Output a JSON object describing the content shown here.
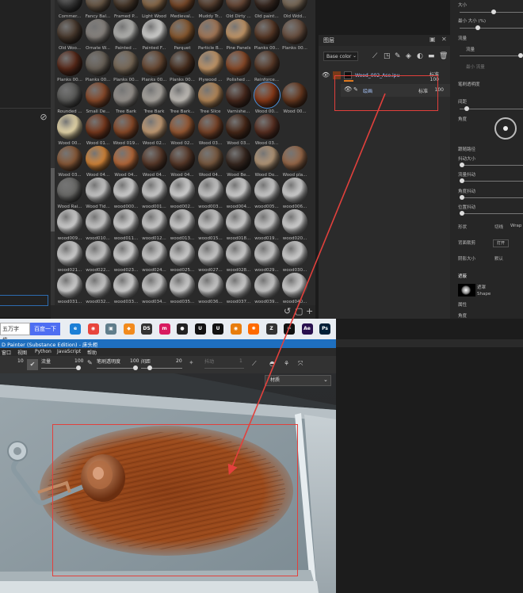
{
  "material_grid": {
    "rows": [
      [
        "Commer...",
        "Fancy Bal...",
        "Framed P...",
        "Light Wood",
        "Medieval...",
        "Muddy Tr...",
        "Old Dirty ...",
        "Old paint...",
        "Old Wdd..."
      ],
      [
        "Old Woo...",
        "Ornate W...",
        "Painted ...",
        "Painted F...",
        "Parquet",
        "Particle B...",
        "Pine Panels",
        "Planks 00...",
        "Planks 00..."
      ],
      [
        "Planks 00...",
        "Planks 00...",
        "Planks 00...",
        "Planks 00...",
        "Planks 00...",
        "Plywood ...",
        "Polished ...",
        "Reinforce..."
      ],
      [
        "Rounded ...",
        "Small De...",
        "Tree Bark",
        "Tree Bark",
        "Tree Bark...",
        "Tree Slice",
        "Varnishe...",
        "Wood 00...",
        "Wood 00..."
      ],
      [
        "Wood 00...",
        "Wood 01...",
        "Wood 019...",
        "Wood 02...",
        "Wood 02...",
        "Wood 03...",
        "Wood 03...",
        "Wood 03..."
      ],
      [
        "Wood 03...",
        "Wood 04...",
        "Wood 04...",
        "Wood 04...",
        "Wood 04...",
        "Wood 04...",
        "Wood Be...",
        "Wood Do...",
        "Wood pla..."
      ],
      [
        "Wood Rai...",
        "Wood Tid...",
        "wood000...",
        "wood001...",
        "wood002...",
        "wood003...",
        "wood004...",
        "wood005...",
        "wood006..."
      ],
      [
        "wood009...",
        "wood010...",
        "wood011...",
        "wood012...",
        "wood013...",
        "wood015...",
        "wood018...",
        "wood019...",
        "wood020..."
      ],
      [
        "wood021...",
        "wood022...",
        "wood023...",
        "wood024...",
        "wood025...",
        "wood027...",
        "wood028...",
        "wood029...",
        "wood030..."
      ],
      [
        "wood031...",
        "wood032...",
        "wood033...",
        "wood034...",
        "wood035...",
        "wood036...",
        "wood037...",
        "wood039...",
        "wood040..."
      ]
    ]
  },
  "layers_panel": {
    "title": "图层",
    "channel_select": "Base color",
    "layers": [
      {
        "name": "Wood_002_Ase.ipu",
        "blend": "标准",
        "opacity": "100"
      },
      {
        "name": "绘画",
        "blend": "标准",
        "opacity": "100"
      }
    ]
  },
  "properties": {
    "labels": [
      "大小",
      "最小 大小 (%)",
      "流量",
      "流量",
      "最小 流量",
      "笔刷透明度",
      "间距",
      "角度",
      "跟随路径",
      "抖动大小",
      "流量抖动",
      "角度抖动",
      "位置抖动",
      "形状",
      "背面裁剪",
      "阴影大小",
      "遮蔽",
      "属性",
      "角度"
    ],
    "shape_name": "Shape",
    "shape_label": "遮罩",
    "open_button": "打开",
    "shape_option_a": "切线",
    "shape_option_b": "Wrap",
    "shadow_value": "默认"
  },
  "taskbar": {
    "search_value": "五万字件...",
    "baidu_button": "百度一下",
    "icons": [
      "edge-icon",
      "chrome-icon",
      "photos-icon",
      "app-icon",
      "ds-icon",
      "m-icon",
      "obs-icon",
      "unreal-icon",
      "unreal-icon-2",
      "blender-icon",
      "houdini-icon",
      "zbrush-icon",
      "capcut-icon",
      "ae-icon",
      "ps-icon",
      "ai-icon",
      "maya-icon",
      "wechat-icon",
      "c4d-icon",
      "files-icon",
      "notes-icon",
      "doc-icon",
      "steam-icon",
      "app2-icon"
    ]
  },
  "app": {
    "title": "D Painter (Substance Edition) - 床头柜",
    "menu": [
      "窗口",
      "视图",
      "Python",
      "JavaScript",
      "帮助"
    ],
    "toolbar": {
      "size_value": "10",
      "flow_label": "流量",
      "flow_value": "100",
      "opacity_label": "笔刷透明度",
      "opacity_value": "100",
      "spacing_label": "间距",
      "spacing_value": "20",
      "stroke_label": "抖动",
      "stroke_value": "1"
    },
    "view_dropdown": "材质"
  },
  "colors": {
    "accent_blue": "#1e6fbf",
    "annotation_red": "#e2403c",
    "taskbar_bg": "#e9edf2"
  }
}
